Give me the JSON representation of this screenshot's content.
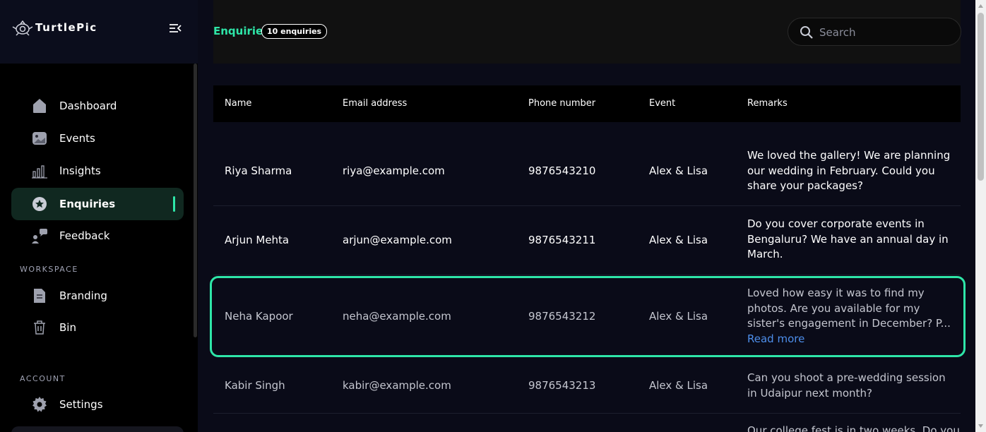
{
  "brand": {
    "name": "TurtlePic"
  },
  "sidebar": {
    "items": [
      {
        "label": "Dashboard",
        "icon": "home-icon"
      },
      {
        "label": "Events",
        "icon": "image-icon"
      },
      {
        "label": "Insights",
        "icon": "bar-chart-icon"
      },
      {
        "label": "Enquiries",
        "icon": "star-badge-icon",
        "active": true
      },
      {
        "label": "Feedback",
        "icon": "feedback-icon"
      }
    ],
    "workspace_label": "WORKSPACE",
    "workspace_items": [
      {
        "label": "Branding",
        "icon": "document-icon"
      },
      {
        "label": "Bin",
        "icon": "trash-icon"
      }
    ],
    "account_label": "ACCOUNT",
    "account_items": [
      {
        "label": "Settings",
        "icon": "gear-icon"
      }
    ]
  },
  "header": {
    "title": "Enquiries",
    "count_badge": "10 enquiries",
    "search_placeholder": "Search"
  },
  "table": {
    "columns": [
      "Name",
      "Email address",
      "Phone number",
      "Event",
      "Remarks"
    ],
    "rows": [
      {
        "name": "Riya Sharma",
        "email": "riya@example.com",
        "phone": "9876543210",
        "event": "Alex & Lisa",
        "remarks": "We loved the gallery! We are planning our wedding in February. Could you share your packages?"
      },
      {
        "name": "Arjun Mehta",
        "email": "arjun@example.com",
        "phone": "9876543211",
        "event": "Alex & Lisa",
        "remarks": "Do you cover corporate events in Bengaluru? We have an annual day in March."
      },
      {
        "name": "Neha Kapoor",
        "email": "neha@example.com",
        "phone": "9876543212",
        "event": "Alex & Lisa",
        "remarks": "Loved how easy it was to find my photos. Are you available for my sister's engagement in December? P...",
        "read_more": "Read more"
      },
      {
        "name": "Kabir Singh",
        "email": "kabir@example.com",
        "phone": "9876543213",
        "event": "Alex & Lisa",
        "remarks": "Can you shoot a pre-wedding session in Udaipur next month?"
      },
      {
        "remarks": "Our college fest is in two weeks. Do you"
      }
    ]
  },
  "colors": {
    "accent": "#2ee6a8",
    "link": "#4d8eea",
    "background": "#0a0b18"
  }
}
